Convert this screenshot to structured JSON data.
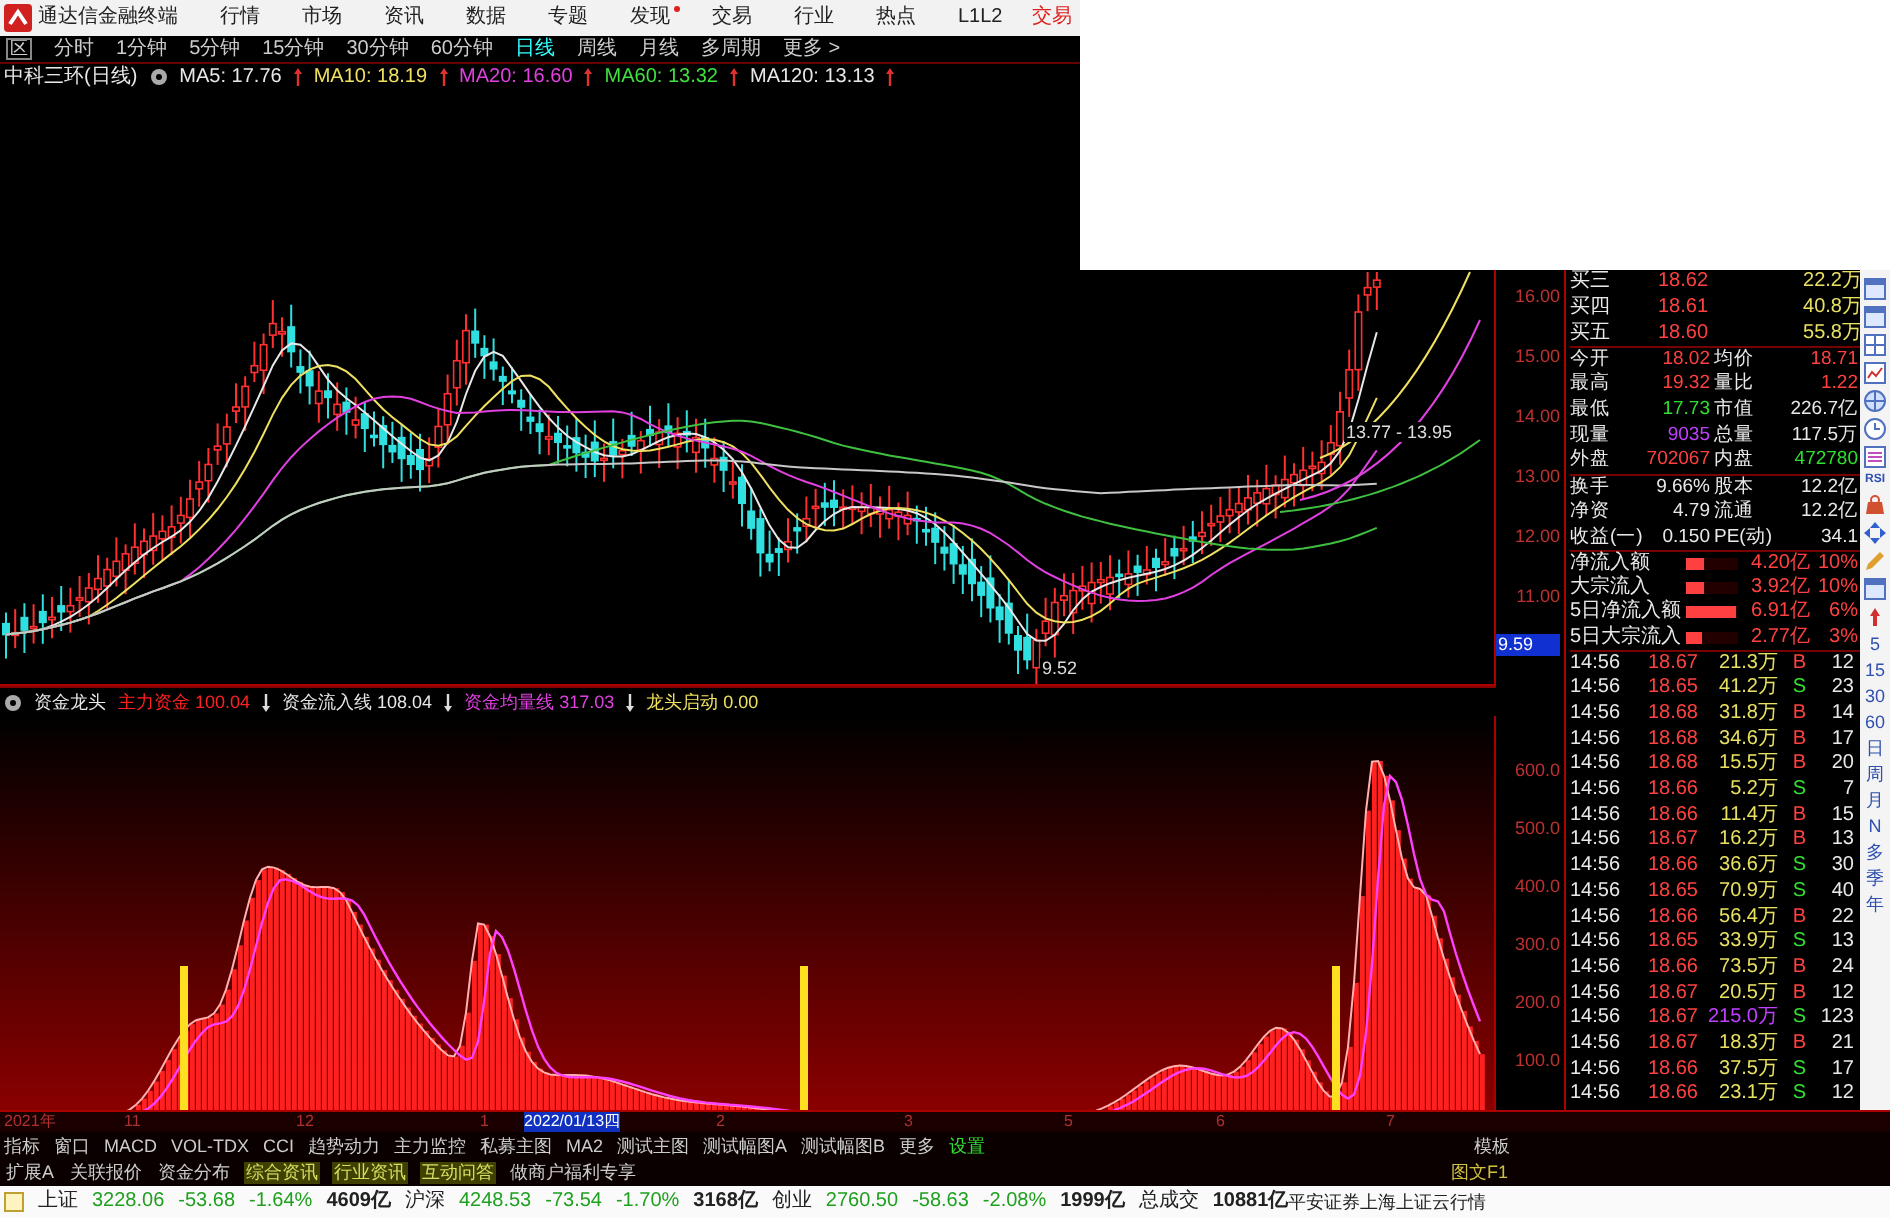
{
  "menu": {
    "title": "通达信金融终端",
    "items": [
      {
        "label": "行情",
        "dot": false
      },
      {
        "label": "市场",
        "dot": false
      },
      {
        "label": "资讯",
        "dot": false
      },
      {
        "label": "数据",
        "dot": false
      },
      {
        "label": "专题",
        "dot": false
      },
      {
        "label": "发现",
        "dot": true
      },
      {
        "label": "交易",
        "dot": false
      },
      {
        "label": "行业",
        "dot": false
      },
      {
        "label": "热点",
        "dot": false
      },
      {
        "label": "L1L2",
        "dot": false
      }
    ],
    "trade": "交易"
  },
  "period_prefix": "区",
  "periods": [
    {
      "label": "分时",
      "selected": false
    },
    {
      "label": "1分钟",
      "selected": false
    },
    {
      "label": "5分钟",
      "selected": false
    },
    {
      "label": "15分钟",
      "selected": false
    },
    {
      "label": "30分钟",
      "selected": false
    },
    {
      "label": "60分钟",
      "selected": false
    },
    {
      "label": "日线",
      "selected": true
    },
    {
      "label": "周线",
      "selected": false
    },
    {
      "label": "月线",
      "selected": false
    },
    {
      "label": "多周期",
      "selected": false
    },
    {
      "label": "更多 >",
      "selected": false
    }
  ],
  "ma_legend": {
    "stock": "中科三环(日线)",
    "items": [
      {
        "text": "MA5: 17.76",
        "color": "#e8e8e8"
      },
      {
        "text": "MA10: 18.19",
        "color": "#f0e060"
      },
      {
        "text": "MA20: 16.60",
        "color": "#e040e0"
      },
      {
        "text": "MA60: 13.32",
        "color": "#40e040"
      },
      {
        "text": "MA120: 13.13",
        "color": "#e8e8e8"
      }
    ]
  },
  "chart_labels": {
    "range": "13.77 - 13.95",
    "low": "9.52"
  },
  "price_axis": [
    "16.00",
    "15.00",
    "14.00",
    "13.00",
    "12.00",
    "11.00"
  ],
  "price_marker": "9.59",
  "quote": {
    "depth": [
      {
        "label": "买三",
        "price": "18.62",
        "volume": "22.2万"
      },
      {
        "label": "买四",
        "price": "18.61",
        "volume": "40.8万"
      },
      {
        "label": "买五",
        "price": "18.60",
        "volume": "55.8万"
      }
    ],
    "stats": [
      {
        "cells": [
          {
            "label": "今开",
            "value": "18.02",
            "color": "#ff4040"
          },
          {
            "label": "均价",
            "value": "18.71",
            "color": "#ff4040"
          }
        ]
      },
      {
        "cells": [
          {
            "label": "最高",
            "value": "19.32",
            "color": "#ff4040"
          },
          {
            "label": "量比",
            "value": "1.22",
            "color": "#ff4040"
          }
        ]
      },
      {
        "cells": [
          {
            "label": "最低",
            "value": "17.73",
            "color": "#30e030"
          },
          {
            "label": "市值",
            "value": "226.7亿",
            "color": "#e8e8e8"
          }
        ]
      },
      {
        "cells": [
          {
            "label": "现量",
            "value": "9035",
            "color": "#c040ff"
          },
          {
            "label": "总量",
            "value": "117.5万",
            "color": "#e8e8e8"
          }
        ]
      },
      {
        "cells": [
          {
            "label": "外盘",
            "value": "702067",
            "color": "#ff4040"
          },
          {
            "label": "内盘",
            "value": "472780",
            "color": "#30e030"
          }
        ]
      },
      {
        "cells": [
          {
            "label": "换手",
            "value": "9.66%",
            "color": "#e8e8e8"
          },
          {
            "label": "股本",
            "value": "12.2亿",
            "color": "#e8e8e8"
          }
        ]
      },
      {
        "cells": [
          {
            "label": "净资",
            "value": "4.79",
            "color": "#e8e8e8"
          },
          {
            "label": "流通",
            "value": "12.2亿",
            "color": "#e8e8e8"
          }
        ]
      },
      {
        "cells": [
          {
            "label": "收益(一)",
            "value": "0.150",
            "color": "#e8e8e8"
          },
          {
            "label": "PE(动)",
            "value": "34.1",
            "color": "#e8e8e8"
          }
        ]
      }
    ],
    "flows": [
      {
        "label": "净流入额",
        "level": 0.35,
        "amount": "4.20亿",
        "pct": "10%"
      },
      {
        "label": "大宗流入",
        "level": 0.35,
        "amount": "3.92亿",
        "pct": "10%"
      },
      {
        "label": "5日净流入额",
        "level": 0.95,
        "amount": "6.91亿",
        "pct": "6%"
      },
      {
        "label": "5日大宗流入",
        "level": 0.3,
        "amount": "2.77亿",
        "pct": "3%"
      }
    ],
    "ticks": [
      {
        "time": "14:56",
        "price": "18.67",
        "volume": "21.3万",
        "large": false,
        "side": "B",
        "count": "12"
      },
      {
        "time": "14:56",
        "price": "18.65",
        "volume": "41.2万",
        "large": false,
        "side": "S",
        "count": "23"
      },
      {
        "time": "14:56",
        "price": "18.68",
        "volume": "31.8万",
        "large": false,
        "side": "B",
        "count": "14"
      },
      {
        "time": "14:56",
        "price": "18.68",
        "volume": "34.6万",
        "large": false,
        "side": "B",
        "count": "17"
      },
      {
        "time": "14:56",
        "price": "18.68",
        "volume": "15.5万",
        "large": false,
        "side": "B",
        "count": "20"
      },
      {
        "time": "14:56",
        "price": "18.66",
        "volume": "5.2万",
        "large": false,
        "side": "S",
        "count": "7"
      },
      {
        "time": "14:56",
        "price": "18.66",
        "volume": "11.4万",
        "large": false,
        "side": "B",
        "count": "15"
      },
      {
        "time": "14:56",
        "price": "18.67",
        "volume": "16.2万",
        "large": false,
        "side": "B",
        "count": "13"
      },
      {
        "time": "14:56",
        "price": "18.66",
        "volume": "36.6万",
        "large": false,
        "side": "S",
        "count": "30"
      },
      {
        "time": "14:56",
        "price": "18.65",
        "volume": "70.9万",
        "large": false,
        "side": "S",
        "count": "40"
      },
      {
        "time": "14:56",
        "price": "18.66",
        "volume": "56.4万",
        "large": false,
        "side": "B",
        "count": "22"
      },
      {
        "time": "14:56",
        "price": "18.65",
        "volume": "33.9万",
        "large": false,
        "side": "S",
        "count": "13"
      },
      {
        "time": "14:56",
        "price": "18.66",
        "volume": "73.5万",
        "large": false,
        "side": "B",
        "count": "24"
      },
      {
        "time": "14:56",
        "price": "18.67",
        "volume": "20.5万",
        "large": false,
        "side": "B",
        "count": "12"
      },
      {
        "time": "14:56",
        "price": "18.67",
        "volume": "215.0万",
        "large": true,
        "side": "S",
        "count": "123"
      },
      {
        "time": "14:56",
        "price": "18.67",
        "volume": "18.3万",
        "large": false,
        "side": "B",
        "count": "21"
      },
      {
        "time": "14:56",
        "price": "18.66",
        "volume": "37.5万",
        "large": false,
        "side": "S",
        "count": "17"
      },
      {
        "time": "14:56",
        "price": "18.66",
        "volume": "23.1万",
        "large": false,
        "side": "S",
        "count": "12"
      }
    ]
  },
  "toolbar": {
    "rsi": "RSI",
    "periods": [
      "5",
      "15",
      "30",
      "60",
      "日",
      "周",
      "月",
      "N",
      "多",
      "季",
      "年"
    ]
  },
  "indicator": {
    "name": "资金龙头",
    "values": [
      {
        "text": "主力资金 100.04",
        "color": "#ff2020"
      },
      {
        "text": "资金流入线 108.04",
        "color": "#e8e8e8"
      },
      {
        "text": "资金均量线 317.03",
        "color": "#e040e0"
      },
      {
        "text": "龙头启动 0.00",
        "color": "#f0e060"
      }
    ],
    "axis": [
      "600.0",
      "500.0",
      "400.0",
      "300.0",
      "200.0",
      "100.0"
    ]
  },
  "dates": [
    {
      "label": "2021年",
      "selected": false
    },
    {
      "label": "11",
      "selected": false
    },
    {
      "label": "12",
      "selected": false
    },
    {
      "label": "1",
      "selected": false
    },
    {
      "label": "2022/01/13四",
      "selected": true
    },
    {
      "label": "2",
      "selected": false
    },
    {
      "label": "3",
      "selected": false
    },
    {
      "label": "5",
      "selected": false
    },
    {
      "label": "6",
      "selected": false
    },
    {
      "label": "7",
      "selected": false
    }
  ],
  "tabs": [
    {
      "label": "指标",
      "kind": "tab"
    },
    {
      "label": "窗口",
      "kind": "tab"
    },
    {
      "label": "MACD",
      "kind": "tab"
    },
    {
      "label": "VOL-TDX",
      "kind": "tab"
    },
    {
      "label": "CCI",
      "kind": "tab"
    },
    {
      "label": "趋势动力",
      "kind": "tab"
    },
    {
      "label": "主力监控",
      "kind": "tab"
    },
    {
      "label": "私募主图",
      "kind": "tab"
    },
    {
      "label": "MA2",
      "kind": "tab"
    },
    {
      "label": "测试主图",
      "kind": "tab"
    },
    {
      "label": "测试幅图A",
      "kind": "tab"
    },
    {
      "label": "测试幅图B",
      "kind": "tab"
    },
    {
      "label": "更多",
      "kind": "tab"
    },
    {
      "label": "设置",
      "kind": "setting"
    }
  ],
  "template": "模板",
  "tabs2": [
    {
      "label": "扩展A",
      "highlighted": false
    },
    {
      "label": "关联报价",
      "highlighted": false
    },
    {
      "label": "资金分布",
      "highlighted": false
    },
    {
      "label": "综合资讯",
      "highlighted": true
    },
    {
      "label": "行业资讯",
      "highlighted": true
    },
    {
      "label": "互动问答",
      "highlighted": true
    },
    {
      "label": "做商户福利专享",
      "highlighted": false
    }
  ],
  "f10": "图文F1",
  "status": {
    "indices": [
      {
        "name": "上证",
        "value": "3228.06",
        "change": "-53.68",
        "pct": "-1.64%",
        "amount": "4609亿"
      },
      {
        "name": "沪深",
        "value": "4248.53",
        "change": "-73.54",
        "pct": "-1.70%",
        "amount": "3168亿"
      },
      {
        "name": "创业",
        "value": "2760.50",
        "change": "-58.63",
        "pct": "-2.08%",
        "amount": "1999亿"
      }
    ],
    "total_label": "总成交",
    "total": "10881亿",
    "source": "平安证券上海上证云行情"
  }
}
